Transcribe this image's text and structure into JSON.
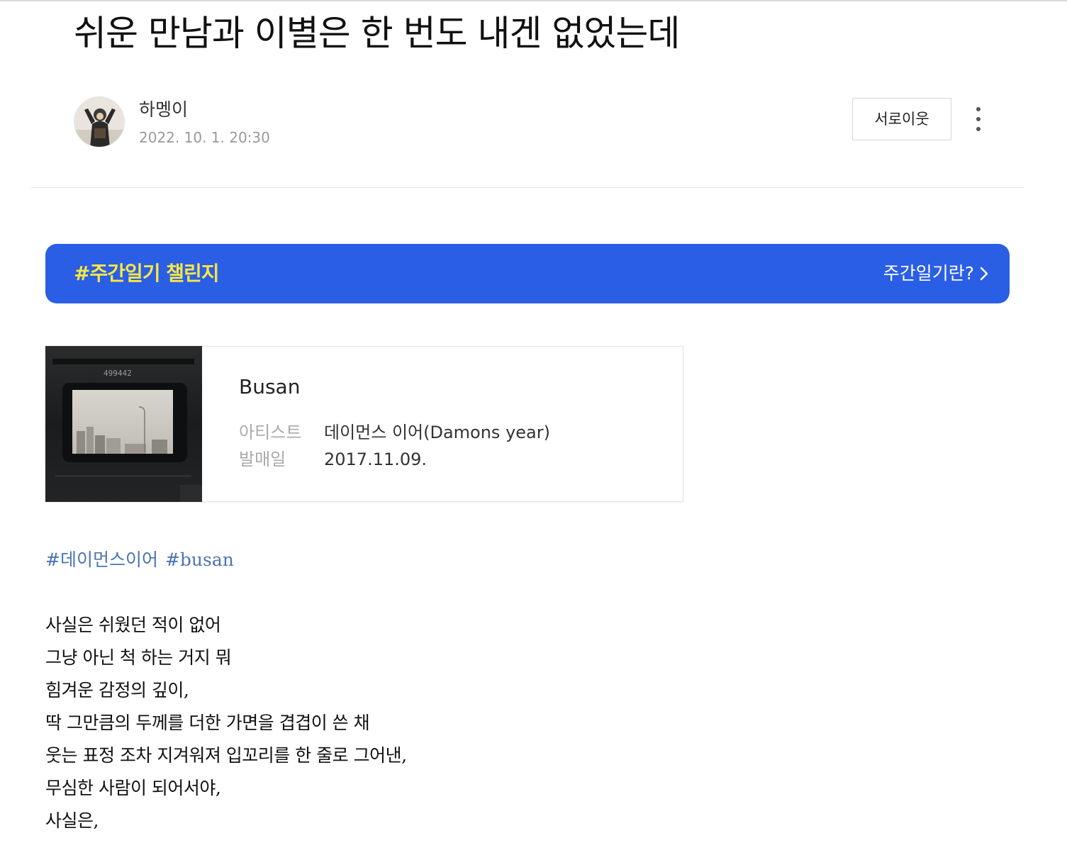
{
  "post": {
    "title": "쉬운 만남과 이별은 한 번도 내겐 없었는데",
    "author": "하멩이",
    "date": "2022. 10. 1. 20:30"
  },
  "actions": {
    "neighbor_label": "서로이웃",
    "more_icon": "vertical-ellipsis-icon"
  },
  "banner": {
    "title": "#주간일기 챌린지",
    "link_label": "주간일기란?",
    "link_icon": "chevron-right-icon",
    "background": "#2a5ee5",
    "title_color": "#f7e645"
  },
  "music": {
    "song_title": "Busan",
    "artist_label": "아티스트",
    "artist": "데이먼스 이어(Damons year)",
    "release_label": "발매일",
    "release_date": "2017.11.09.",
    "album_art_text": "499442"
  },
  "hashtags": [
    "#데이먼스이어",
    "#busan"
  ],
  "lyrics": [
    "사실은 쉬웠던 적이 없어",
    "그냥 아닌 척 하는 거지 뭐",
    "힘겨운 감정의 깊이,",
    "딱 그만큼의 두께를 더한 가면을 겹겹이 쓴 채",
    "웃는 표정 조차 지겨워져 입꼬리를 한 줄로 그어낸,",
    "무심한 사람이 되어서야,",
    "사실은,"
  ]
}
